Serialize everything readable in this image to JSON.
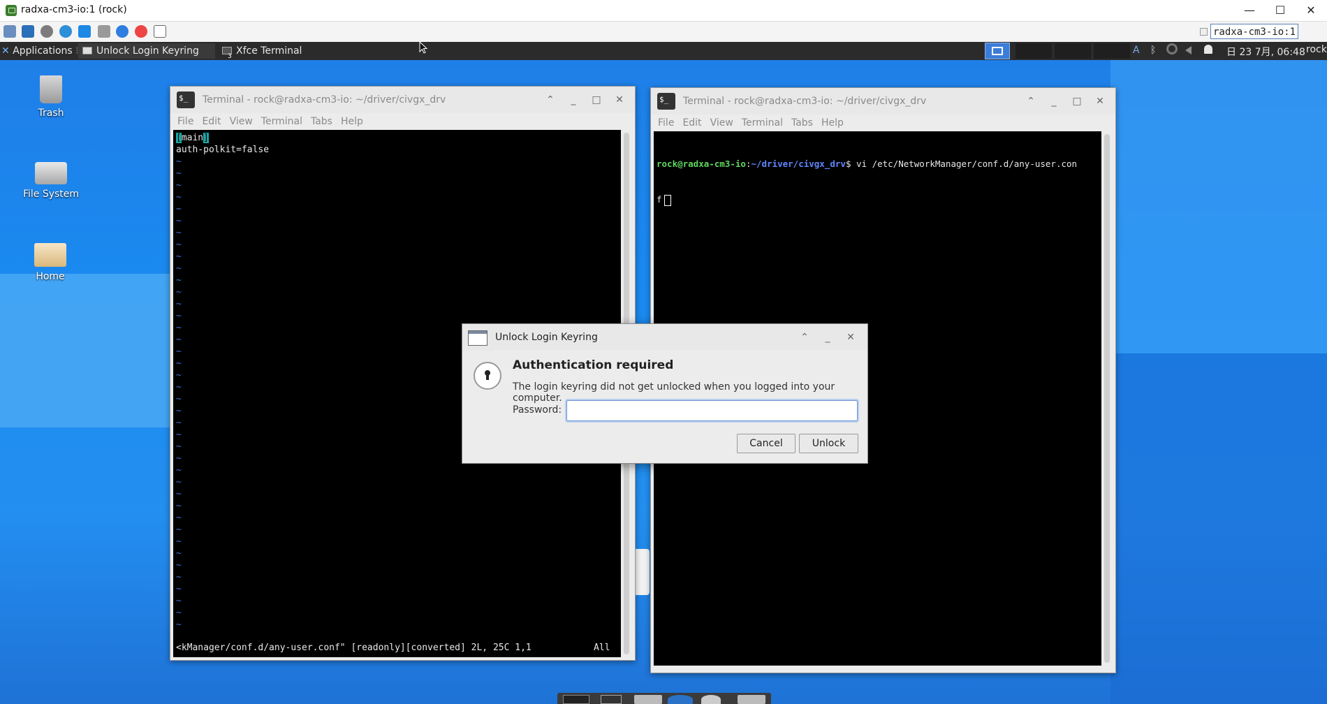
{
  "vnc": {
    "title": "radxa-cm3-io:1 (rock)",
    "host_field": "radxa-cm3-io:1",
    "minimize": "—",
    "maximize": "☐",
    "close": "✕"
  },
  "panel": {
    "applications": "Applications",
    "tasks": [
      {
        "label": "Unlock Login Keyring",
        "active": true
      },
      {
        "label": "Xfce Terminal",
        "active": false,
        "badge": "3"
      }
    ],
    "tray": {
      "keyboard": "A",
      "bluetooth": "ᛒ"
    },
    "clock": "日 23  7月, 06:48",
    "user": "rock"
  },
  "desktop": {
    "icons": [
      {
        "label": "Trash",
        "icon": "trash-icon"
      },
      {
        "label": "File System",
        "icon": "drive-icon"
      },
      {
        "label": "Home",
        "icon": "home-folder-icon"
      }
    ]
  },
  "term_left": {
    "title": "Terminal - rock@radxa-cm3-io: ~/driver/civgx_drv",
    "menu": [
      "File",
      "Edit",
      "View",
      "Terminal",
      "Tabs",
      "Help"
    ],
    "lines": [
      "main",
      "auth-polkit=false"
    ],
    "line1_open": "[",
    "line1_close": "]",
    "tilde": "~",
    "status": "<kManager/conf.d/any-user.conf\" [readonly][converted] 2L, 25C 1,1",
    "status_pos": "All"
  },
  "term_right": {
    "title": "Terminal - rock@radxa-cm3-io: ~/driver/civgx_drv",
    "menu": [
      "File",
      "Edit",
      "View",
      "Terminal",
      "Tabs",
      "Help"
    ],
    "prompt_user": "rock@radxa-cm3-io",
    "prompt_sep": ":",
    "prompt_path": "~/driver/civgx_drv",
    "prompt_cmd": "$ vi /etc/NetworkManager/conf.d/any-user.con",
    "wrap": "f "
  },
  "dialog": {
    "title": "Unlock Login Keyring",
    "heading": "Authentication required",
    "message": "The login keyring did not get unlocked when you logged into your computer.",
    "password_label": "Password:",
    "password_value": "",
    "cancel": "Cancel",
    "unlock": "Unlock"
  },
  "colors": {
    "prompt_green": "#5fd75f",
    "prompt_blue": "#5f87ff",
    "accent": "#3b7dd8"
  }
}
